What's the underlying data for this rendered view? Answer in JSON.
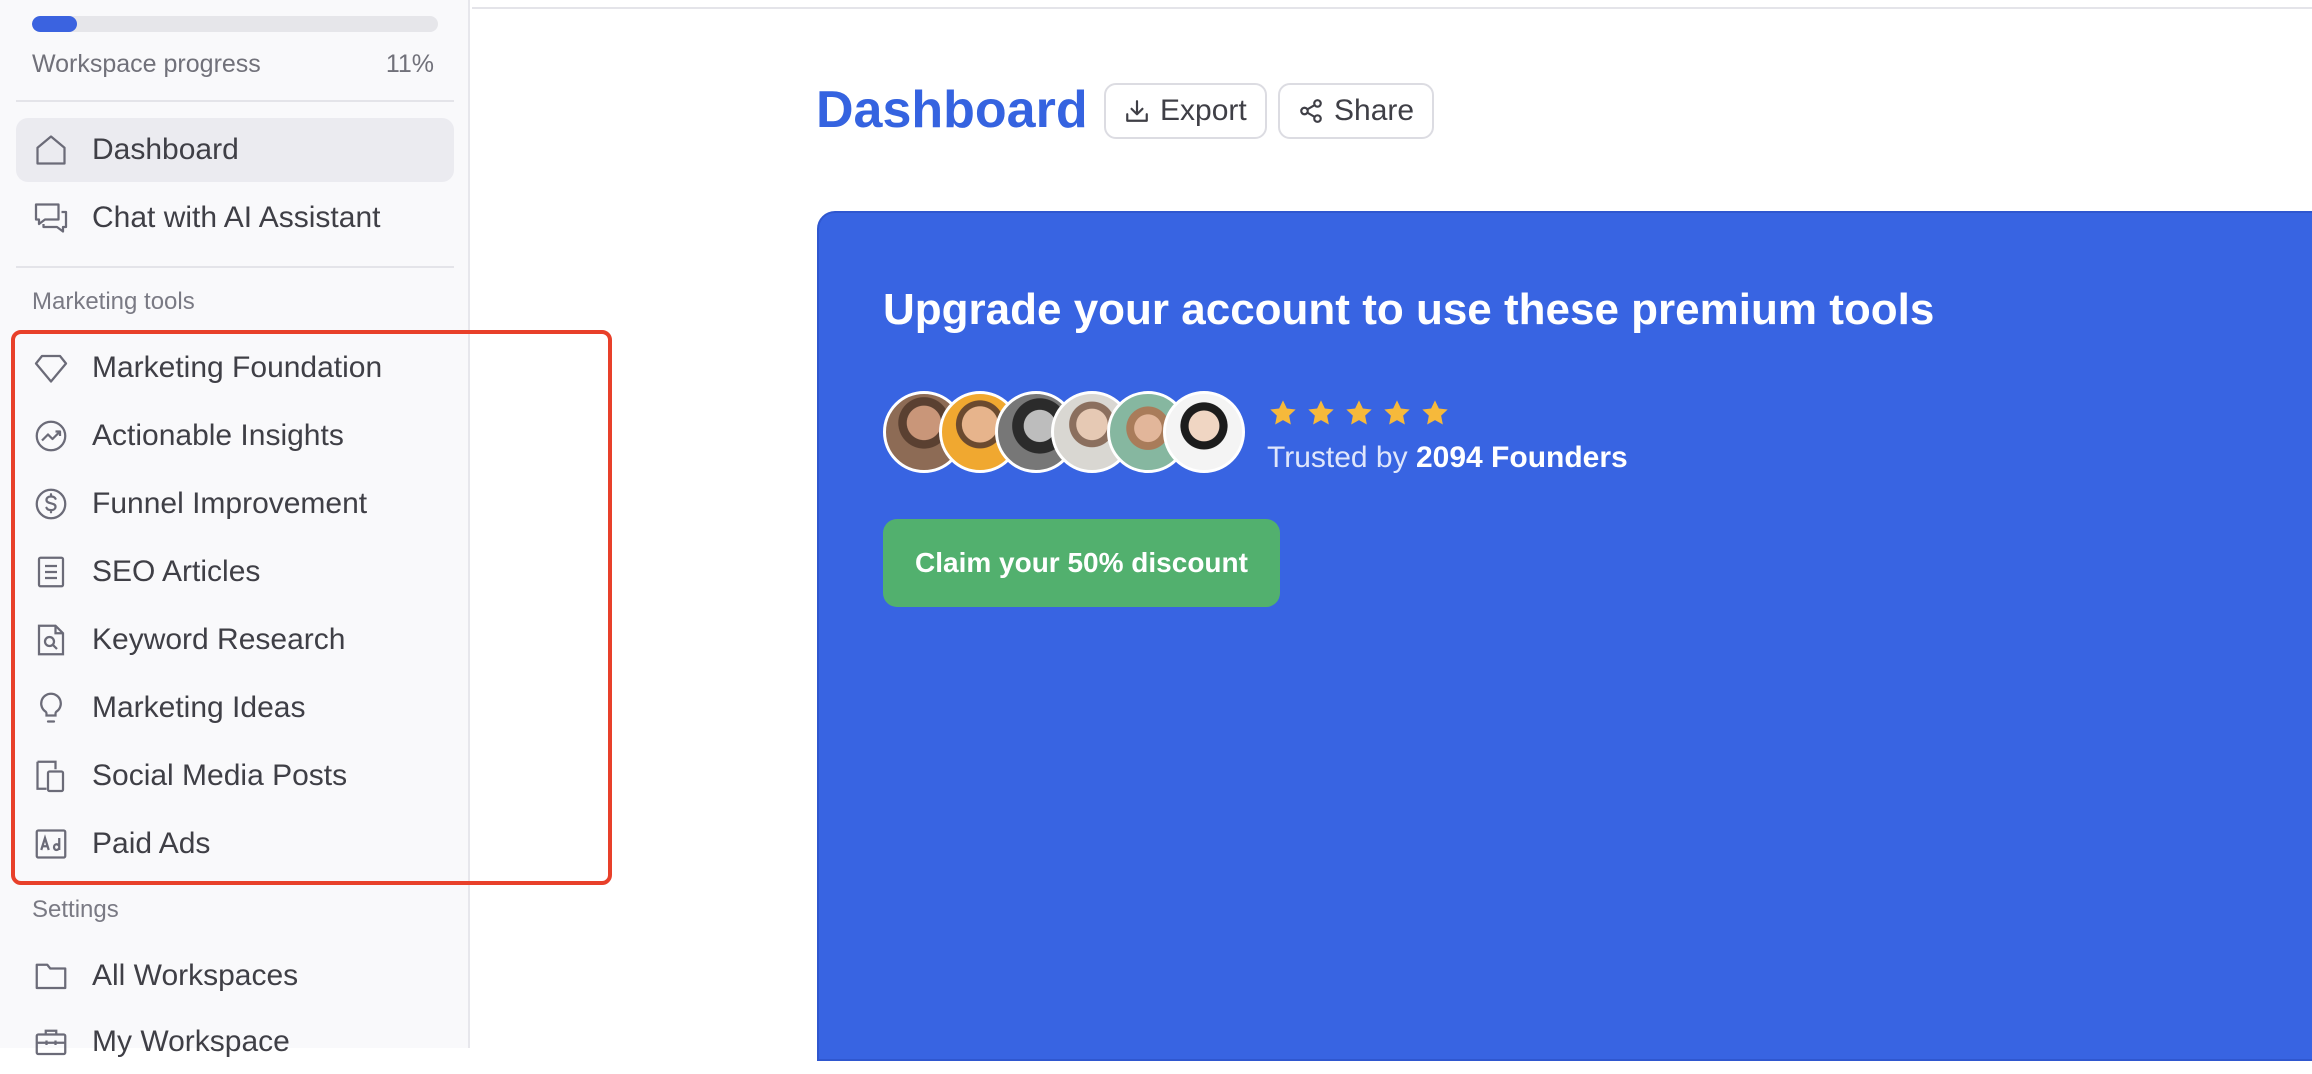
{
  "sidebar": {
    "progress": {
      "label": "Workspace progress",
      "percent_text": "11%",
      "value": 0.11
    },
    "main_items": [
      {
        "label": "Dashboard",
        "icon": "home-icon",
        "active": true
      },
      {
        "label": "Chat with AI Assistant",
        "icon": "chat-icon",
        "active": false
      }
    ],
    "marketing_section_label": "Marketing tools",
    "marketing_items": [
      {
        "label": "Marketing Foundation",
        "icon": "diamond-icon"
      },
      {
        "label": "Actionable Insights",
        "icon": "trend-chart-icon"
      },
      {
        "label": "Funnel Improvement",
        "icon": "dollar-circle-icon"
      },
      {
        "label": "SEO Articles",
        "icon": "document-icon"
      },
      {
        "label": "Keyword Research",
        "icon": "search-document-icon"
      },
      {
        "label": "Marketing Ideas",
        "icon": "lightbulb-icon"
      },
      {
        "label": "Social Media Posts",
        "icon": "devices-icon"
      },
      {
        "label": "Paid Ads",
        "icon": "ad-icon"
      }
    ],
    "settings_section_label": "Settings",
    "settings_items": [
      {
        "label": "All Workspaces",
        "icon": "folder-icon"
      },
      {
        "label": "My Workspace",
        "icon": "briefcase-icon"
      }
    ]
  },
  "header": {
    "title": "Dashboard",
    "export_label": "Export",
    "share_label": "Share"
  },
  "promo": {
    "title": "Upgrade your account to use these premium tools",
    "rating_stars": 5,
    "trusted_prefix": "Trusted by",
    "trusted_count": "2094 Founders",
    "cta_label": "Claim your 50% discount"
  },
  "colors": {
    "accent": "#3563e0",
    "promo_bg": "#3864e2",
    "cta_green": "#52b06e",
    "star": "#f6b93b",
    "highlight_red": "#e8402a"
  }
}
